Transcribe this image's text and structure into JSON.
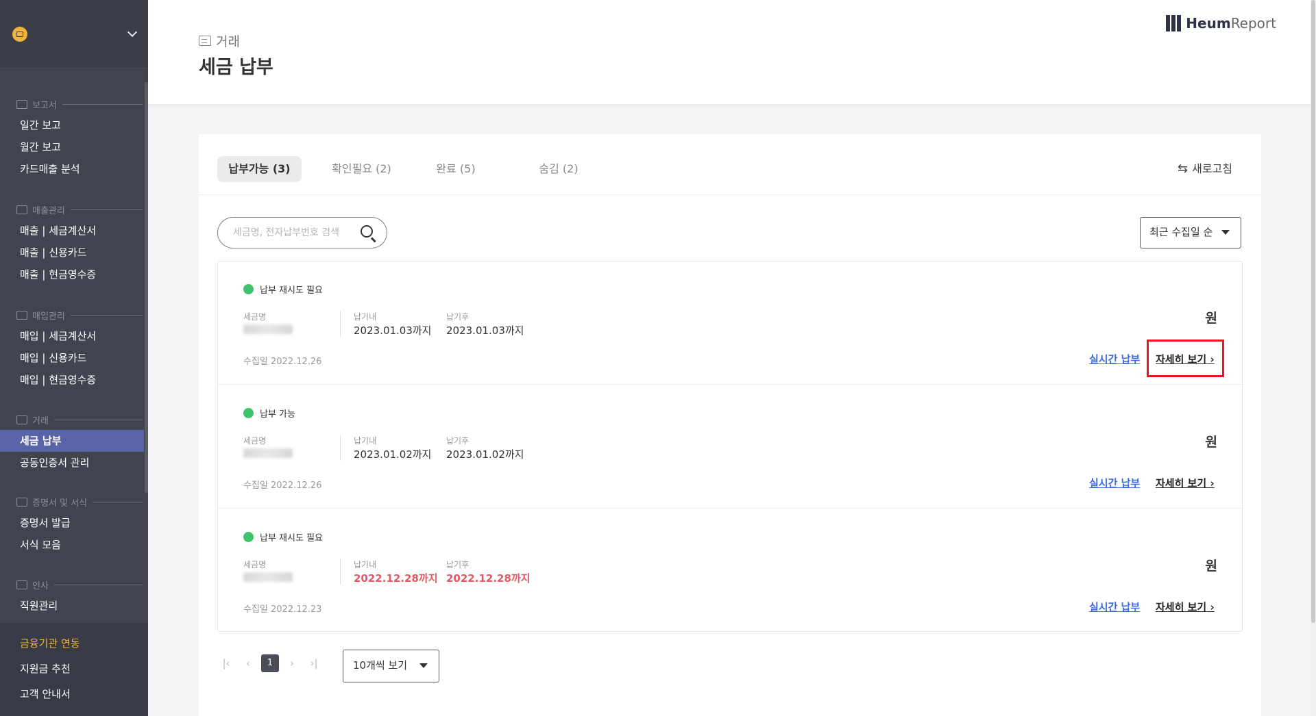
{
  "sidebar": {
    "sections": [
      {
        "title": "보고서",
        "items": [
          "일간 보고",
          "월간 보고",
          "카드매출 분석"
        ]
      },
      {
        "title": "매출관리",
        "items": [
          "매출 | 세금계산서",
          "매출 | 신용카드",
          "매출 | 현금영수증"
        ]
      },
      {
        "title": "매입관리",
        "items": [
          "매입 | 세금계산서",
          "매입 | 신용카드",
          "매입 | 현금영수증"
        ]
      },
      {
        "title": "거래",
        "items": [
          "세금 납부",
          "공동인증서 관리"
        ]
      },
      {
        "title": "증명서 및 서식",
        "items": [
          "증명서 발급",
          "서식 모음"
        ]
      },
      {
        "title": "인사",
        "items": [
          "직원관리"
        ]
      }
    ],
    "bottom": [
      "금융기관 연동",
      "지원금 추천",
      "고객 안내서"
    ],
    "active_item": "세금 납부"
  },
  "header": {
    "breadcrumb": "거래",
    "title": "세금 납부",
    "brand_bold": "Heum",
    "brand_light": "Report"
  },
  "tabs": [
    {
      "label": "납부가능 (3)",
      "active": true
    },
    {
      "label": "확인필요 (2)",
      "active": false
    },
    {
      "label": "완료 (5)",
      "active": false
    },
    {
      "label": "숨김 (2)",
      "active": false
    }
  ],
  "refresh_label": "새로고침",
  "search": {
    "placeholder": "세금명, 전자납부번호 검색"
  },
  "sort": {
    "selected": "최근 수집일 순"
  },
  "labels": {
    "tax_name": "세금명",
    "due_within": "납기내",
    "due_after": "납기후",
    "currency": "원",
    "pay_realtime": "실시간 납부",
    "detail": "자세히 보기"
  },
  "rows": [
    {
      "status": "납부 재시도 필요",
      "due_within": "2023.01.03까지",
      "due_after": "2023.01.03까지",
      "overdue": false,
      "collected": "수집일 2022.12.26"
    },
    {
      "status": "납부 가능",
      "due_within": "2023.01.02까지",
      "due_after": "2023.01.02까지",
      "overdue": false,
      "collected": "수집일 2022.12.26"
    },
    {
      "status": "납부 재시도 필요",
      "due_within": "2022.12.28까지",
      "due_after": "2022.12.28까지",
      "overdue": true,
      "collected": "수집일 2022.12.23"
    }
  ],
  "pagination": {
    "current_page": "1",
    "per_page": "10개씩 보기"
  },
  "colors": {
    "accent": "#5b63a8",
    "status_ok": "#3ec46d",
    "link": "#3d6be0",
    "overdue": "#e05a66",
    "highlight": "#e8141e"
  }
}
